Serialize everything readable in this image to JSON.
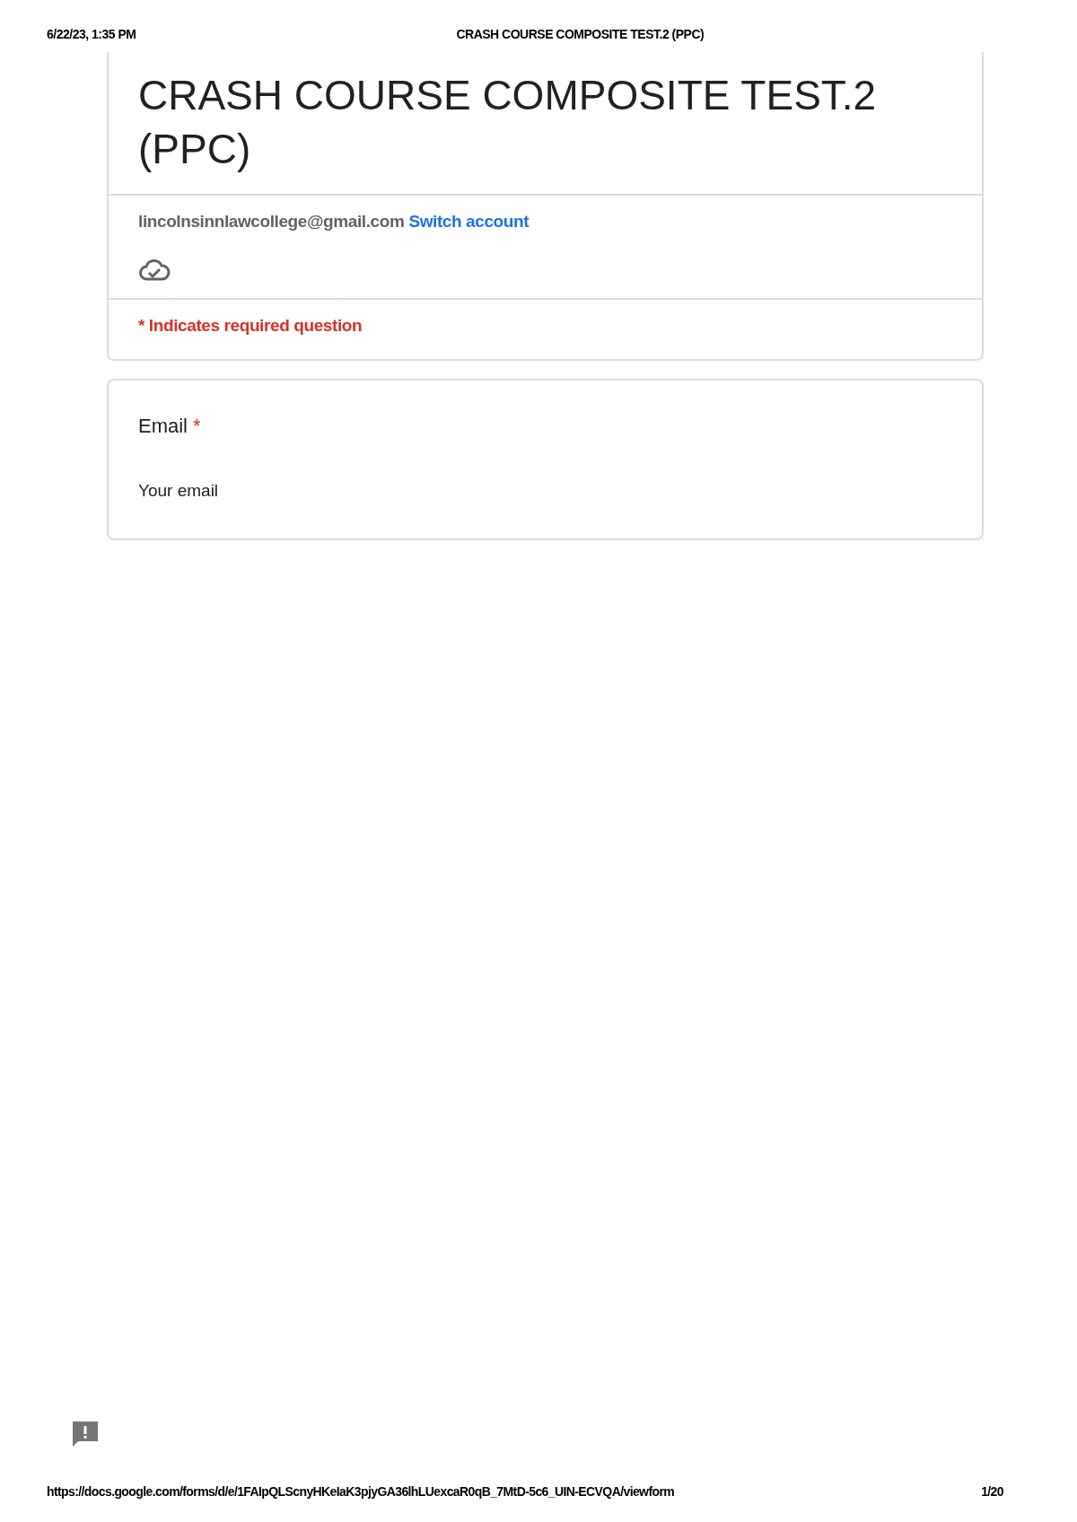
{
  "print_header": {
    "date": "6/22/23, 1:35 PM",
    "title": "CRASH COURSE COMPOSITE TEST.2 (PPC)"
  },
  "form_header": {
    "title": "CRASH COURSE COMPOSITE TEST.2 (PPC)",
    "account_email": "lincolnsinnlawcollege@gmail.com",
    "switch_account": "Switch account",
    "required_note": "* Indicates required question"
  },
  "questions": [
    {
      "label": "Email",
      "required": true,
      "required_mark": "*",
      "placeholder": "Your email"
    }
  ],
  "print_footer": {
    "url": "https://docs.google.com/forms/d/e/1FAIpQLScnyHKeIaK3pjyGA36lhLUexcaR0qB_7MtD-5c6_UIN-ECVQA/viewform",
    "page": "1/20"
  }
}
